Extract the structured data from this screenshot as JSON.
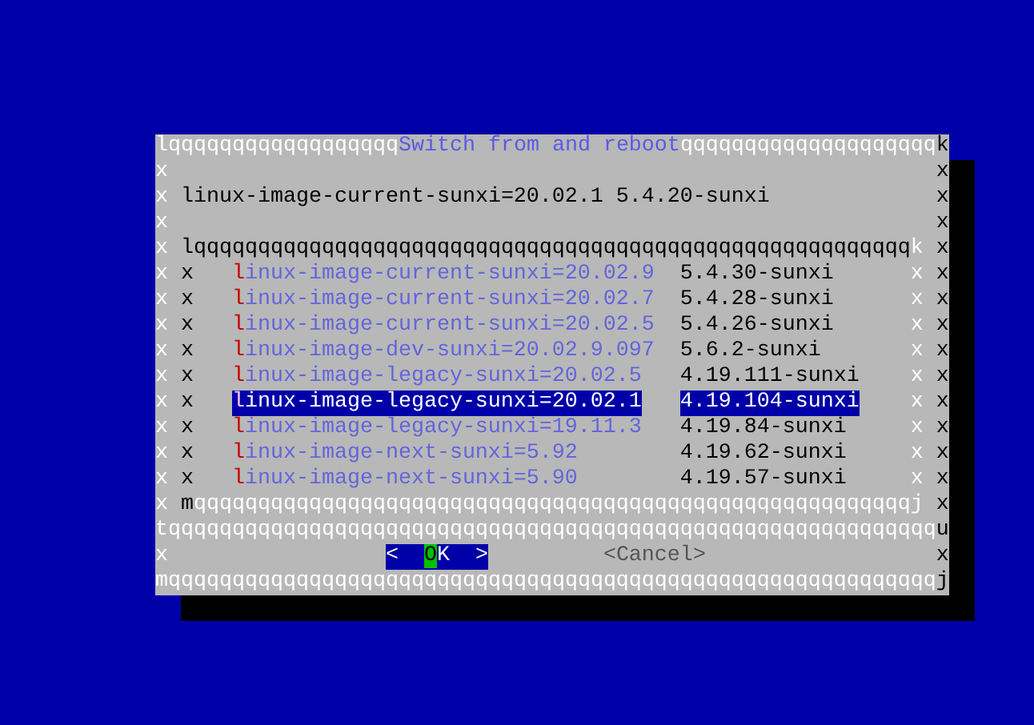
{
  "dialog": {
    "rows": [
      {
        "kind": "top",
        "left": "l",
        "rule_left": "qqqqqqqqqqqqqqqqqq",
        "title": "Switch from and reboot",
        "rule_right": "qqqqqqqqqqqqqqqqqqqq",
        "right": "k"
      },
      {
        "kind": "blank",
        "left": "x",
        "right": "x"
      },
      {
        "kind": "message",
        "left": "x",
        "text": "linux-image-current-sunxi=20.02.1 5.4.20-sunxi",
        "right": "x"
      },
      {
        "kind": "blank",
        "left": "x",
        "right": "x"
      },
      {
        "kind": "list_top",
        "left": "x",
        "inner_left": "l",
        "rule": "qqqqqqqqqqqqqqqqqqqqqqqqqqqqqqqqqqqqqqqqqqqqqqqqqqqqqqqq",
        "inner_right": "k",
        "right": "x"
      },
      {
        "kind": "item",
        "left": "x",
        "inner_left": "x",
        "label": "linux-image-current-sunxi=20.02.9",
        "version": "5.4.30-sunxi",
        "selected": false,
        "inner_right": "x",
        "right": "x"
      },
      {
        "kind": "item",
        "left": "x",
        "inner_left": "x",
        "label": "linux-image-current-sunxi=20.02.7",
        "version": "5.4.28-sunxi",
        "selected": false,
        "inner_right": "x",
        "right": "x"
      },
      {
        "kind": "item",
        "left": "x",
        "inner_left": "x",
        "label": "linux-image-current-sunxi=20.02.5",
        "version": "5.4.26-sunxi",
        "selected": false,
        "inner_right": "x",
        "right": "x"
      },
      {
        "kind": "item",
        "left": "x",
        "inner_left": "x",
        "label": "linux-image-dev-sunxi=20.02.9.097",
        "version": "5.6.2-sunxi",
        "selected": false,
        "inner_right": "x",
        "right": "x"
      },
      {
        "kind": "item",
        "left": "x",
        "inner_left": "x",
        "label": "linux-image-legacy-sunxi=20.02.5",
        "version": "4.19.111-sunxi",
        "selected": false,
        "inner_right": "x",
        "right": "x"
      },
      {
        "kind": "item",
        "left": "x",
        "inner_left": "x",
        "label": "linux-image-legacy-sunxi=20.02.1",
        "version": "4.19.104-sunxi",
        "selected": true,
        "inner_right": "x",
        "right": "x"
      },
      {
        "kind": "item",
        "left": "x",
        "inner_left": "x",
        "label": "linux-image-legacy-sunxi=19.11.3",
        "version": "4.19.84-sunxi",
        "selected": false,
        "inner_right": "x",
        "right": "x"
      },
      {
        "kind": "item",
        "left": "x",
        "inner_left": "x",
        "label": "linux-image-next-sunxi=5.92",
        "version": "4.19.62-sunxi",
        "selected": false,
        "inner_right": "x",
        "right": "x"
      },
      {
        "kind": "item",
        "left": "x",
        "inner_left": "x",
        "label": "linux-image-next-sunxi=5.90",
        "version": "4.19.57-sunxi",
        "selected": false,
        "inner_right": "x",
        "right": "x"
      },
      {
        "kind": "list_bottom",
        "left": "x",
        "inner_left": "m",
        "rule": "qqqqqqqqqqqqqqqqqqqqqqqqqqqqqqqqqqqqqqqqqqqqqqqqqqqqqqqq",
        "inner_right": "j",
        "right": "x"
      },
      {
        "kind": "separator",
        "left": "t",
        "rule": "qqqqqqqqqqqqqqqqqqqqqqqqqqqqqqqqqqqqqqqqqqqqqqqqqqqqqqqqqqqq",
        "right": "u"
      },
      {
        "kind": "buttons",
        "left": "x",
        "buttons": [
          {
            "open": "<",
            "label": "OK",
            "close": ">",
            "selected": true
          },
          {
            "open": "<",
            "label": "Cancel",
            "close": ">",
            "selected": false
          }
        ],
        "right": "x"
      },
      {
        "kind": "bottom",
        "left": "m",
        "rule": "qqqqqqqqqqqqqqqqqqqqqqqqqqqqqqqqqqqqqqqqqqqqqqqqqqqqqqqqqqqq",
        "right": "j"
      }
    ]
  }
}
